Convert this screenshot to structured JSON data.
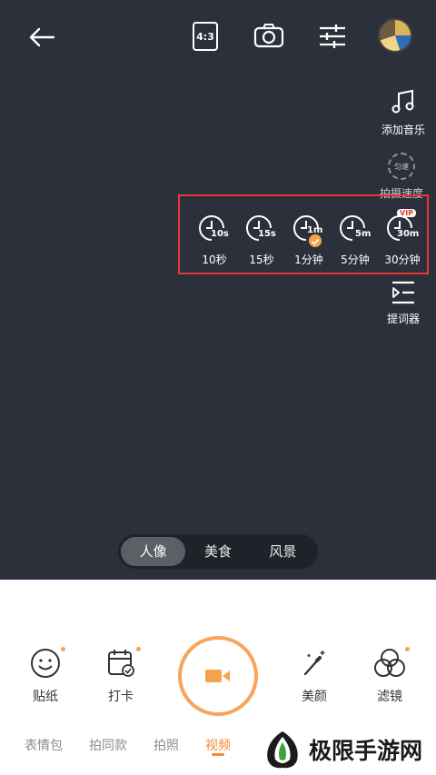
{
  "top_bar": {
    "ratio_label": "4:3",
    "icons": {
      "back": "arrow-left-icon",
      "flip": "camera-flip-icon",
      "adjust": "sliders-icon"
    }
  },
  "side_menu": {
    "music_label": "添加音乐",
    "speed_badge": "匀速",
    "speed_label": "拍摄速度",
    "prompter_label": "提词器"
  },
  "durations": [
    {
      "sub": "10s",
      "label": "10秒",
      "selected": false,
      "vip": false
    },
    {
      "sub": "15s",
      "label": "15秒",
      "selected": false,
      "vip": false
    },
    {
      "sub": "1m",
      "label": "1分钟",
      "selected": true,
      "vip": false
    },
    {
      "sub": "5m",
      "label": "5分钟",
      "selected": false,
      "vip": false
    },
    {
      "sub": "30m",
      "label": "30分钟",
      "selected": false,
      "vip": true,
      "badge": "VIP"
    }
  ],
  "modes": {
    "items": [
      "人像",
      "美食",
      "风景"
    ],
    "active": "人像"
  },
  "tools": {
    "sticker": "贴纸",
    "checkin": "打卡",
    "beauty": "美颜",
    "filter": "滤镜"
  },
  "tabs": {
    "items": [
      "表情包",
      "拍同款",
      "拍照",
      "视频"
    ],
    "active": "视频"
  },
  "watermark": {
    "text": "极限手游网"
  },
  "colors": {
    "accent": "#f58a3c",
    "camera_bg": "#2b303a",
    "highlight_border": "#e53935"
  }
}
